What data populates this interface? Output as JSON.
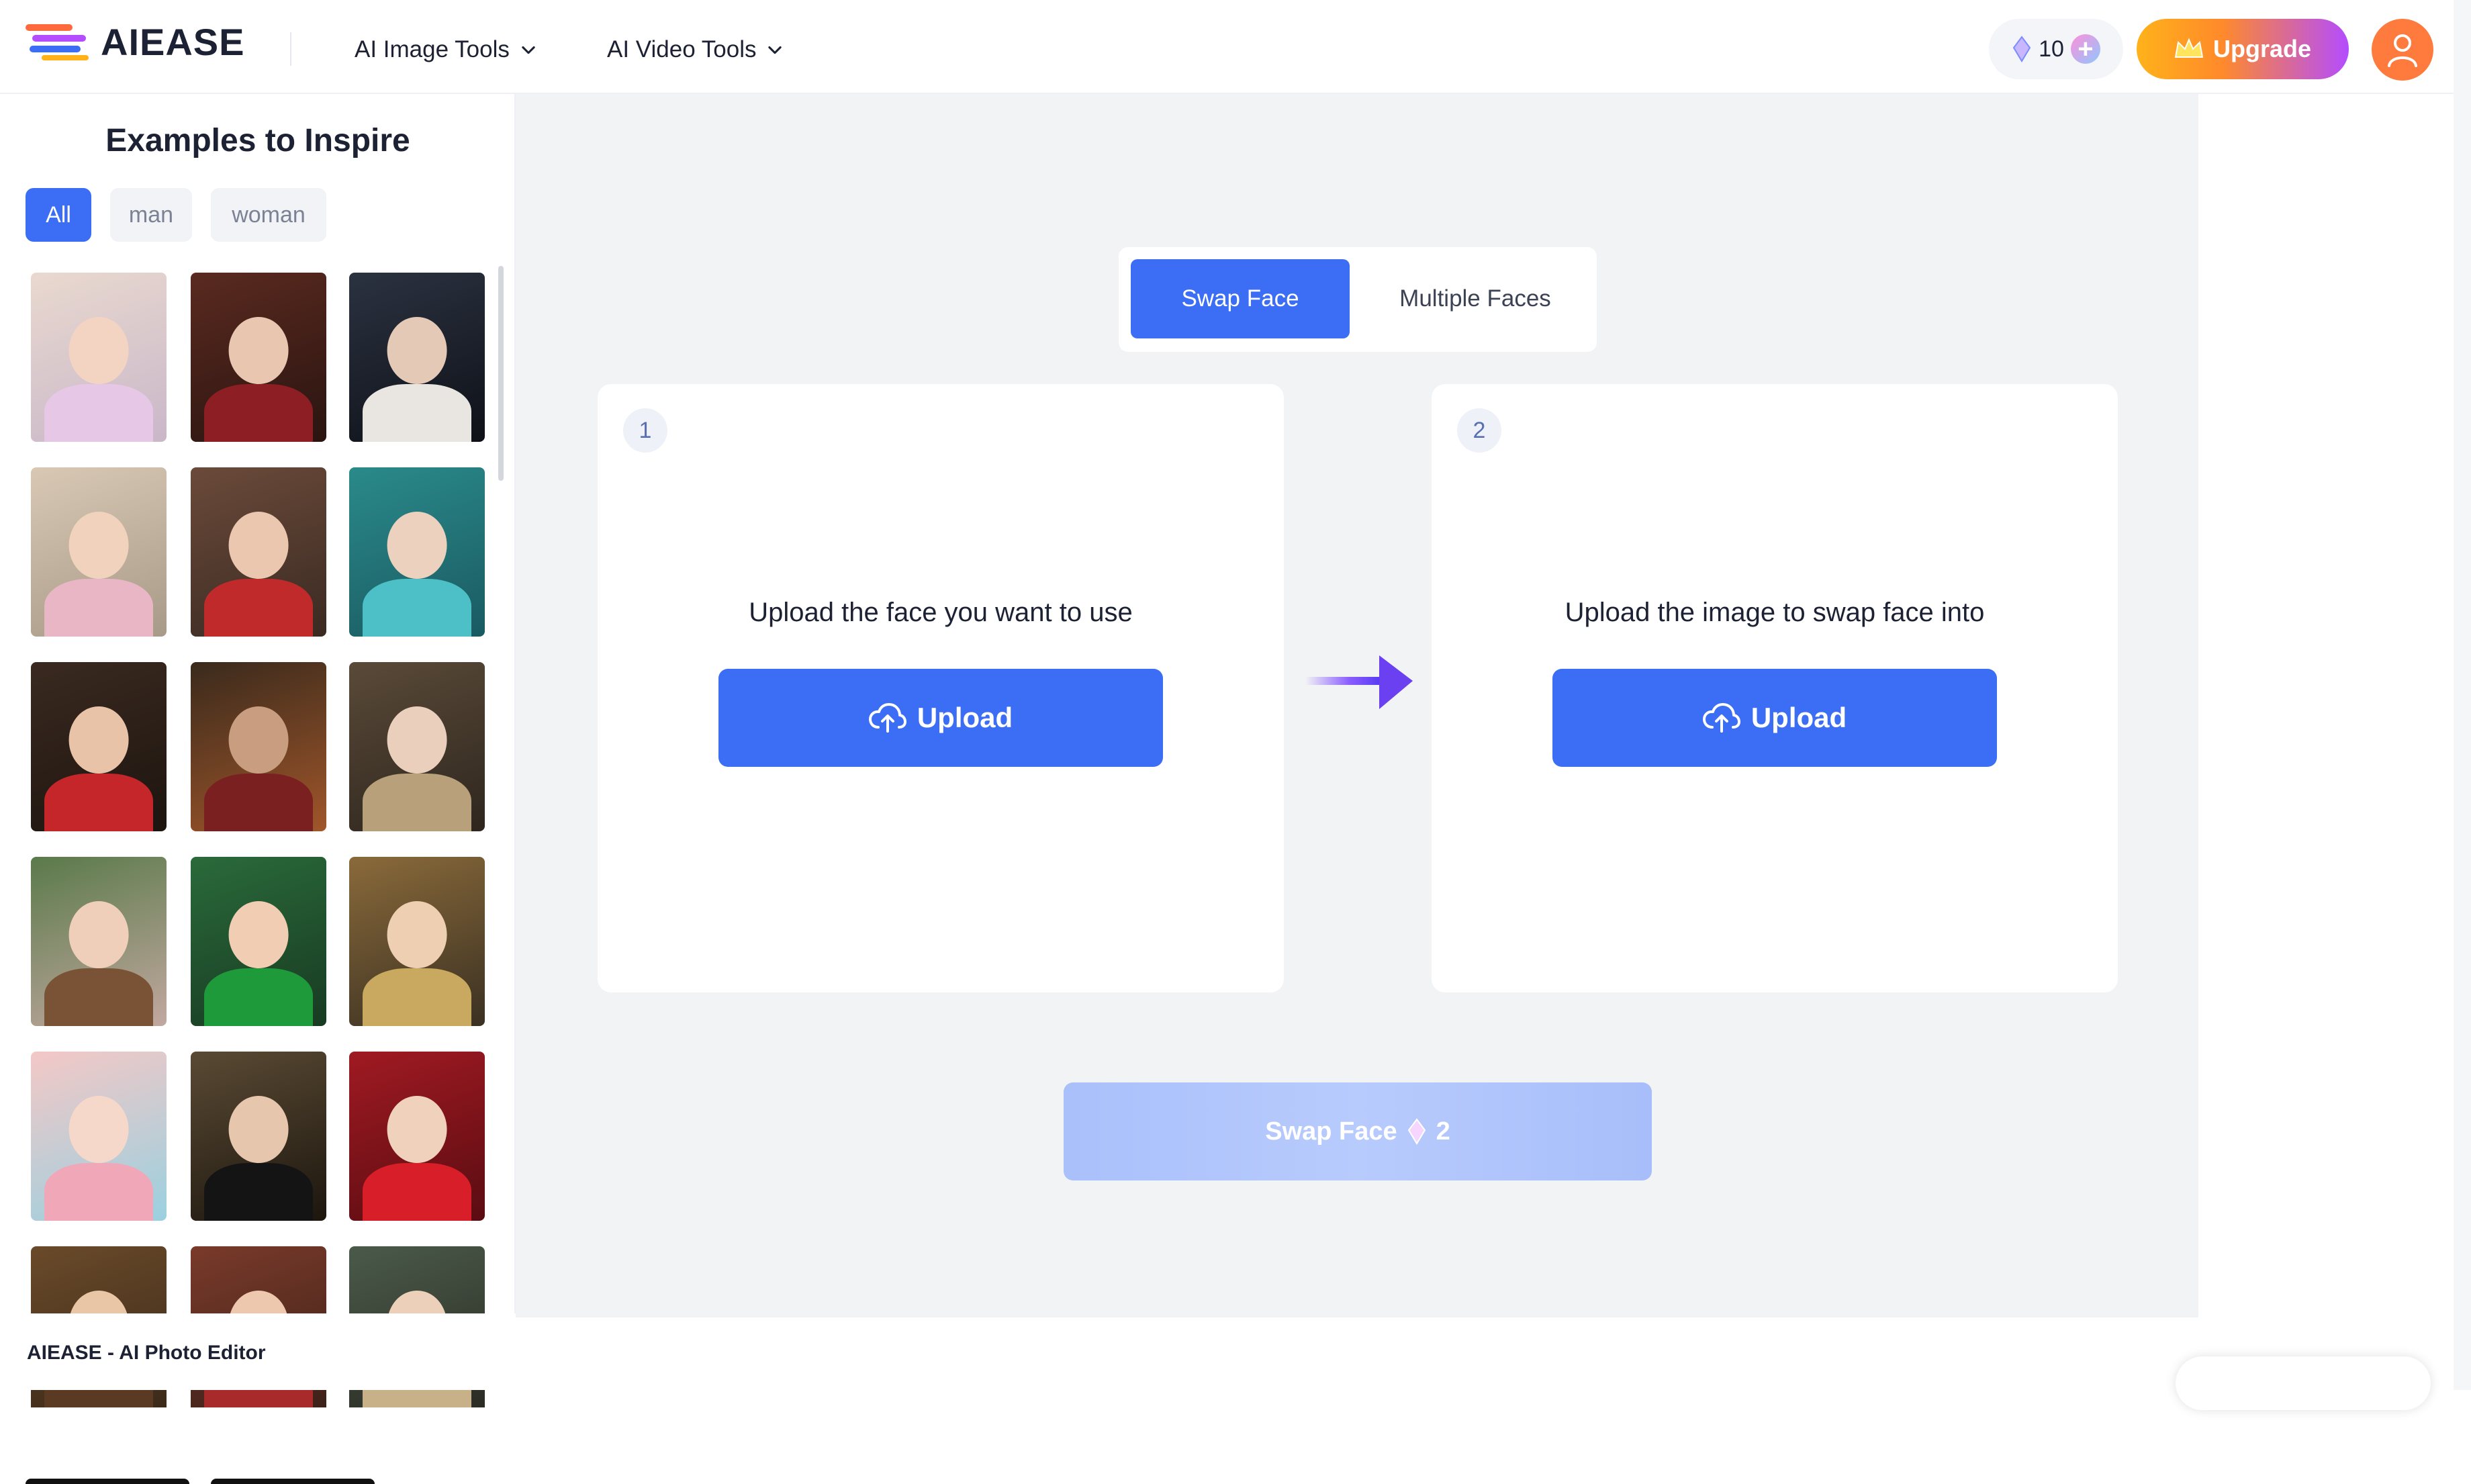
{
  "header": {
    "brand": "AIEASE",
    "nav": [
      {
        "label": "AI Image Tools"
      },
      {
        "label": "AI Video Tools"
      }
    ],
    "credits": "10",
    "upgrade_label": "Upgrade"
  },
  "sidebar": {
    "title": "Examples to Inspire",
    "filters": [
      {
        "label": "All",
        "active": true
      },
      {
        "label": "man",
        "active": false
      },
      {
        "label": "woman",
        "active": false
      }
    ],
    "footer": "AIEASE - AI Photo Editor"
  },
  "main": {
    "tabs": [
      {
        "label": "Swap Face",
        "active": true
      },
      {
        "label": "Multiple Faces",
        "active": false
      }
    ],
    "cards": [
      {
        "step": "1",
        "text": "Upload the face you want to use",
        "button": "Upload"
      },
      {
        "step": "2",
        "text": "Upload the image to swap face into",
        "button": "Upload"
      }
    ],
    "swap_button": {
      "label": "Swap Face",
      "cost": "2"
    }
  },
  "colors": {
    "accent": "#3b6df5",
    "disabled": "#a9c0fb",
    "background": "#f2f3f5"
  }
}
